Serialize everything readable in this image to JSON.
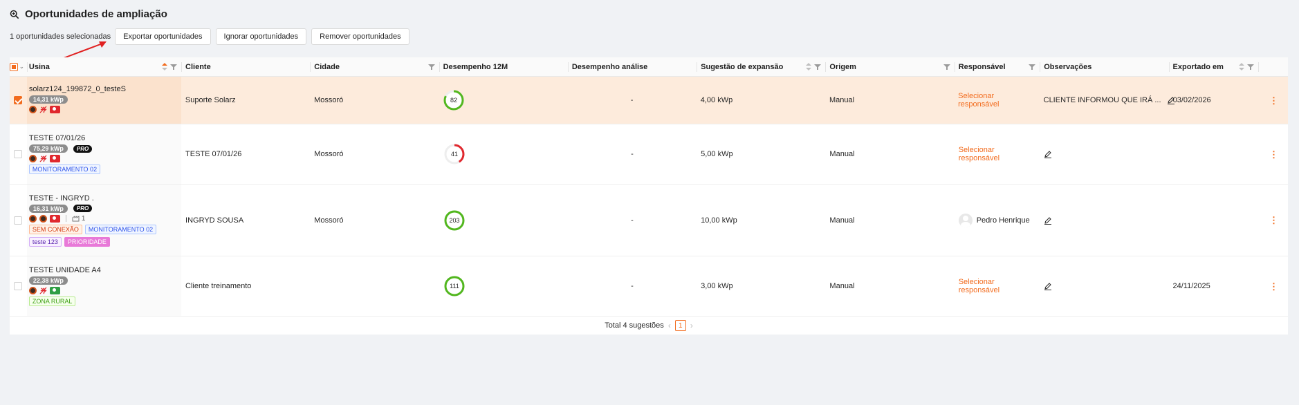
{
  "header": {
    "title": "Oportunidades de ampliação",
    "icon": "zoom-in-icon"
  },
  "actions": {
    "selected_count": "1 oportunidades selecionadas",
    "export": "Exportar oportunidades",
    "ignore": "Ignorar oportunidades",
    "remove": "Remover oportunidades"
  },
  "columns": {
    "usina": "Usina",
    "cliente": "Cliente",
    "cidade": "Cidade",
    "desempenho12m": "Desempenho 12M",
    "desempenho_analise": "Desempenho análise",
    "sugestao": "Sugestão de expansão",
    "origem": "Origem",
    "responsavel": "Responsável",
    "observacoes": "Observações",
    "exportado": "Exportado em"
  },
  "rows": [
    {
      "plant": "solarz124_199872_0_testeS",
      "kwp": "14,31 kWp",
      "cliente": "Suporte Solarz",
      "cidade": "Mossoró",
      "desempenho": "82",
      "desempenho_pct": 0.82,
      "ring_color": "#52b71f",
      "analise": "-",
      "sugestao": "4,00 kWp",
      "origem": "Manual",
      "responsavel": "Selecionar responsável",
      "obs": "CLIENTE INFORMOU QUE IRÁ ...",
      "exportado": "03/02/2026"
    },
    {
      "plant": "TESTE 07/01/26",
      "kwp": "75,29 kWp",
      "pro": "PRO",
      "tags": [
        "MONITORAMENTO 02"
      ],
      "cliente": "TESTE 07/01/26",
      "cidade": "Mossoró",
      "desempenho": "41",
      "desempenho_pct": 0.41,
      "ring_color": "#e0282e",
      "analise": "-",
      "sugestao": "5,00 kWp",
      "origem": "Manual",
      "responsavel": "Selecionar responsável",
      "obs": "",
      "exportado": ""
    },
    {
      "plant": "TESTE - INGRYD .",
      "kwp": "16,31 kWp",
      "pro": "PRO",
      "devices": "1",
      "tags": [
        "SEM CONEXÃO",
        "MONITORAMENTO 02",
        "teste 123",
        "PRIORIDADE"
      ],
      "cliente": "INGRYD SOUSA",
      "cidade": "Mossoró",
      "desempenho": "203",
      "desempenho_pct": 1,
      "ring_color": "#52b71f",
      "analise": "-",
      "sugestao": "10,00 kWp",
      "origem": "Manual",
      "responsavel": "Pedro Henrique",
      "obs": "",
      "exportado": ""
    },
    {
      "plant": "TESTE UNIDADE A4",
      "kwp": "22,38 kWp",
      "tags": [
        "ZONA RURAL"
      ],
      "cliente": "Cliente treinamento",
      "cidade": "",
      "desempenho": "111",
      "desempenho_pct": 1,
      "ring_color": "#52b71f",
      "analise": "-",
      "sugestao": "3,00 kWp",
      "origem": "Manual",
      "responsavel": "Selecionar responsável",
      "obs": "",
      "exportado": "24/11/2025"
    }
  ],
  "footer": {
    "total": "Total 4 sugestões",
    "page": "1"
  },
  "colors": {
    "accent": "#f26b1d",
    "selected_row": "#fdebdc",
    "good": "#52b71f",
    "bad": "#e0282e"
  }
}
